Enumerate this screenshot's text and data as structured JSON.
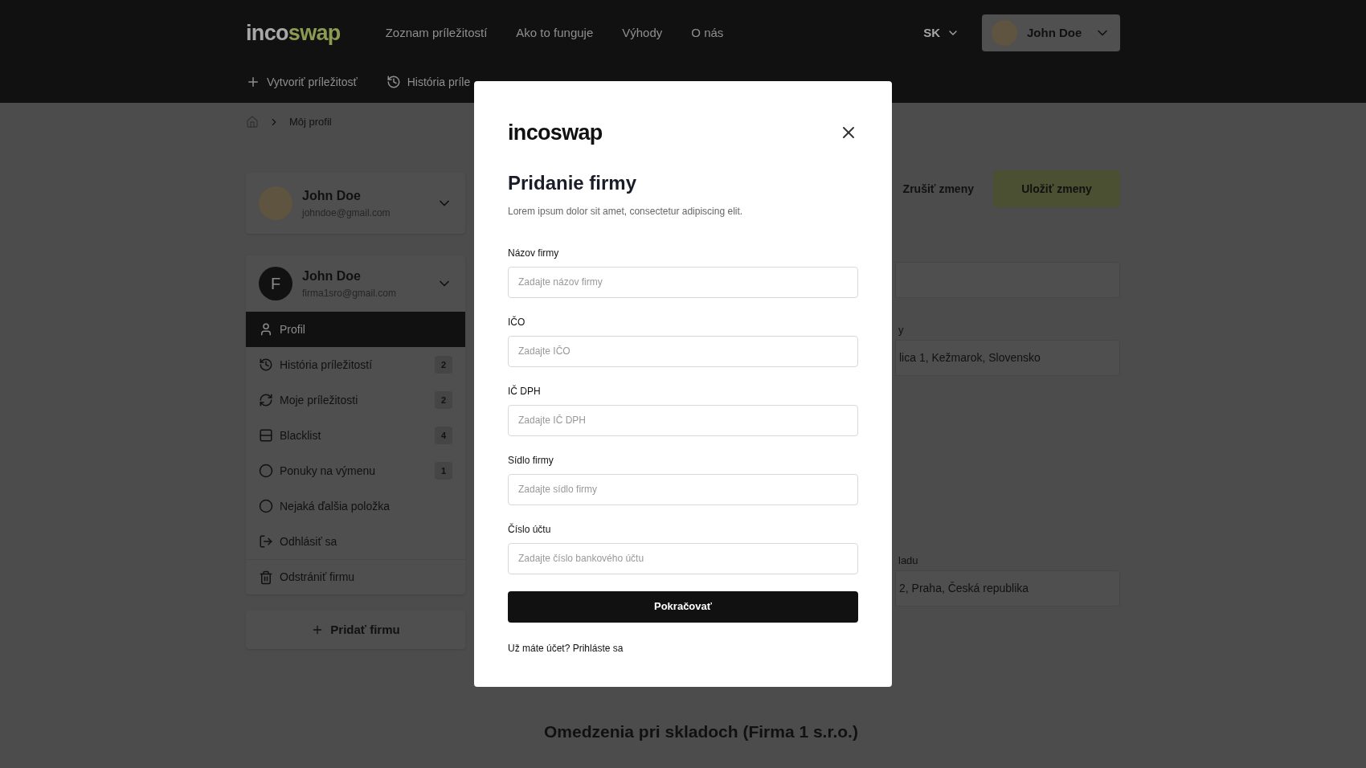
{
  "header": {
    "logo": {
      "first": "inco",
      "second": "swap"
    },
    "nav": [
      "Zoznam príležitostí",
      "Ako to funguje",
      "Výhody",
      "O nás"
    ],
    "language": "SK",
    "user": {
      "name": "John Doe"
    }
  },
  "subnav": [
    {
      "label": "Vytvoriť príležitosť"
    },
    {
      "label": "História príle"
    }
  ],
  "breadcrumb": [
    "Môj profil"
  ],
  "profile_card": {
    "name": "John Doe",
    "email": "johndoe@gmail.com"
  },
  "company_card": {
    "initial": "F",
    "name": "John Doe",
    "email": "firma1sro@gmail.com"
  },
  "menu": [
    {
      "label": "Profil",
      "selected": true
    },
    {
      "label": "História príležitostí",
      "badge": "2",
      "selected": false
    },
    {
      "label": "Moje príležitosti",
      "badge": "2",
      "selected": false
    },
    {
      "label": "Blacklist",
      "badge": "4",
      "selected": false
    },
    {
      "label": "Ponuky na výmenu",
      "badge": "1",
      "selected": false
    },
    {
      "label": "Nejaká ďalšia položka",
      "selected": false
    },
    {
      "label": "Odhlásiť sa",
      "selected": false
    },
    {
      "label": "Odstrániť firmu",
      "selected": false
    }
  ],
  "add_company": "Pridať firmu",
  "actions": {
    "cancel": "Zrušiť zmeny",
    "save": "Uložiť zmeny"
  },
  "right_fields": [
    {
      "kind": "blank"
    },
    {
      "kind": "filled",
      "label": "y",
      "value": "lica 1, Kežmarok, Slovensko"
    },
    {
      "kind": "filled",
      "label": "ladu",
      "value": "2, Praha, Česká republika"
    }
  ],
  "section_title": "Omedzenia pri skladoch (Firma 1 s.r.o.)",
  "modal": {
    "logo": "incoswap",
    "title": "Pridanie firmy",
    "subtitle": "Lorem ipsum dolor sit amet, consectetur adipiscing elit.",
    "fields": [
      {
        "label": "Názov firmy",
        "placeholder": "Zadajte názov firmy"
      },
      {
        "label": "IČO",
        "placeholder": "Zadajte IČO"
      },
      {
        "label": "IČ DPH",
        "placeholder": "Zadajte IČ DPH"
      },
      {
        "label": "Sídlo firmy",
        "placeholder": "Zadajte sídlo firmy"
      },
      {
        "label": "Číslo účtu",
        "placeholder": "Zadajte číslo bankového účtu"
      }
    ],
    "submit": "Pokračovať",
    "footer": "Už máte účet? Prihláste sa"
  }
}
